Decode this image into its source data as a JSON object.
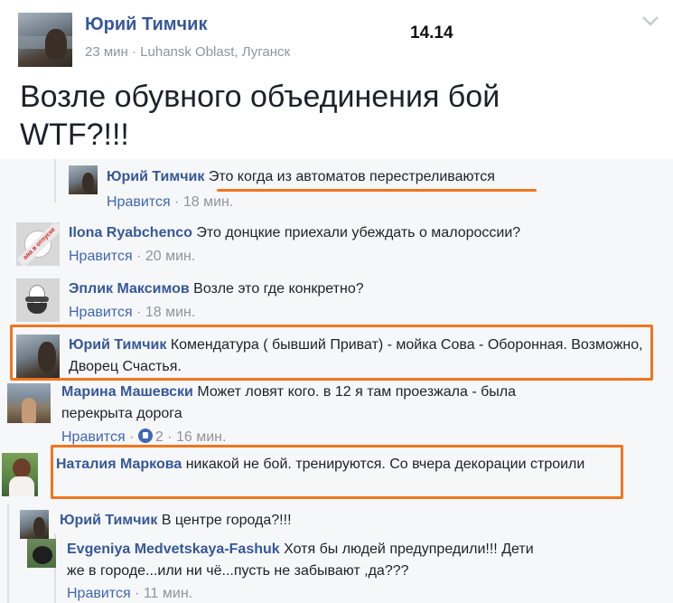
{
  "post": {
    "author": "Юрий Тимчик",
    "time": "23 мин",
    "location": "Luhansk Oblast, Луганск",
    "meta_separator": " · ",
    "stamp": "14.14",
    "text": "Возле обувного объединения бой WTF?!!!"
  },
  "comments": [
    {
      "name": "Юрий Тимчик",
      "text": "Это когда из автоматов перестреливаются",
      "like": "Нравится",
      "time": "18 мин."
    },
    {
      "name": "Ilona Ryabchenco",
      "text": "Это донцкие приехали убеждать о малороссии?",
      "like": "Нравится",
      "time": "20 мин.",
      "avatar_text": "ава в отпуске"
    },
    {
      "name": "Эплик Максимов",
      "text": "Возле это где конкретно?",
      "like": "Нравится",
      "time": "18 мин."
    },
    {
      "name": "Юрий Тимчик",
      "text": "Комендатура ( бывший Приват) - мойка Сова - Оборонная. Возможно, Дворец Счастья."
    },
    {
      "name": "Марина Машевски",
      "text": "Может ловят кого. в 12 я там проезжала - была перекрыта дорога",
      "like": "Нравится",
      "reactions": "2",
      "time": "16 мин."
    },
    {
      "name": "Наталия Маркова",
      "text": "никакой не бой. тренируются. Со вчера декорации строили"
    },
    {
      "name": "Юрий Тимчик",
      "text": "В центре города?!!!"
    },
    {
      "name": "Evgeniya Medvetskaya-Fashuk",
      "text": "Хотя бы людей предупредили!!! Дети же в городе...или ни чё...пусть не забывают ,да???",
      "like": "Нравится",
      "time": "11 мин."
    }
  ],
  "separator": " · ",
  "colors": {
    "name": "#365899",
    "meta": "#90949c",
    "highlight": "#f0751e",
    "like_link": "#4267b2"
  },
  "icons": [
    "chevron-down-icon",
    "like-reaction-icon"
  ]
}
